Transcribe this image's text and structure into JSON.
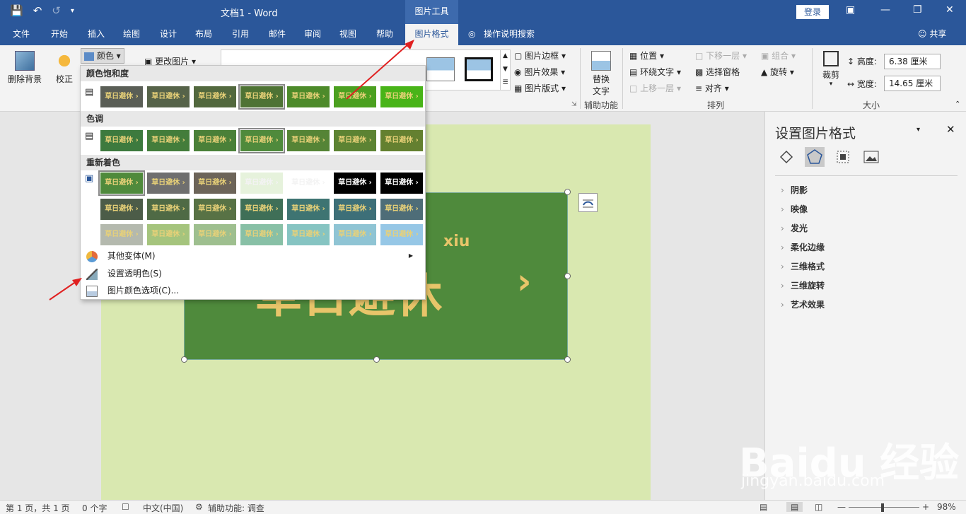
{
  "titlebar": {
    "doc_title": "文档1  -  Word",
    "tool_context": "图片工具",
    "login": "登录",
    "save_icon": "save-icon",
    "undo_icon": "undo-icon"
  },
  "tabs": [
    "文件",
    "开始",
    "插入",
    "绘图",
    "设计",
    "布局",
    "引用",
    "邮件",
    "审阅",
    "视图",
    "帮助",
    "图片格式"
  ],
  "search_label": "操作说明搜索",
  "share_label": "共享",
  "ribbon": {
    "remove_bg": "删除背景",
    "correct": "校正",
    "color": "颜色",
    "change_pic": "更改图片",
    "pic_border": "图片边框",
    "pic_effects": "图片效果",
    "pic_layout": "图片版式",
    "alt_text_1": "替换",
    "alt_text_2": "文字",
    "accessibility_group": "辅助功能",
    "position": "位置",
    "wrap_text": "环绕文字",
    "bring_forward": "上移一层",
    "send_backward": "下移一层",
    "selection_pane": "选择窗格",
    "align": "对齐",
    "group": "组合",
    "rotate": "旋转",
    "arrange_group": "排列",
    "crop": "裁剪",
    "height_label": "高度:",
    "height_value": "6.38 厘米",
    "width_label": "宽度:",
    "width_value": "14.65 厘米",
    "size_group": "大小"
  },
  "dropdown": {
    "section_saturation": "颜色饱和度",
    "section_tone": "色调",
    "section_recolor": "重新着色",
    "swatch_text": "草日避休 ›",
    "more_variants": "其他变体(M)",
    "set_transparent": "设置透明色(S)",
    "color_options": "图片颜色选项(C)...",
    "saturation_colors": [
      "#5a5e56",
      "#566349",
      "#52683e",
      "#4e7334",
      "#4d8a2a",
      "#4ba020",
      "#48b418"
    ],
    "tone_colors": [
      "#3d7a3e",
      "#437d3b",
      "#4a8038",
      "#4f8a3c",
      "#558436",
      "#5c8333",
      "#648030"
    ],
    "recolor_row1": [
      "#4f8a3c",
      "#6f6f6f",
      "#6c6459",
      "#e6f2dc",
      "#ffffff",
      "#000000",
      "#000000"
    ],
    "recolor_row2": [
      "#4c5c48",
      "#4f6a45",
      "#587245",
      "#3f6f57",
      "#3e7472",
      "#3d6f78",
      "#4e6d78"
    ],
    "recolor_row3": [
      "#b4b9ae",
      "#a5c47d",
      "#9ebf8f",
      "#88c0a6",
      "#86c4c2",
      "#8fc4d4",
      "#96c7e6"
    ]
  },
  "picture": {
    "small_text": "xiu",
    "big_text": "草日避休",
    "arrow_text": "›"
  },
  "pane": {
    "title": "设置图片格式",
    "items": [
      "阴影",
      "映像",
      "发光",
      "柔化边缘",
      "三维格式",
      "三维旋转",
      "艺术效果"
    ]
  },
  "status": {
    "page": "第 1 页，共 1 页",
    "words": "0 个字",
    "lang": "中文(中国)",
    "accessibility": "辅助功能: 调查",
    "zoom": "98%"
  },
  "watermark": {
    "logo": "Baidu 经验",
    "url": "jingyan.baidu.com"
  },
  "colors": {
    "brand": "#2b579a",
    "picture_bg": "#4f8a3c",
    "page_bg": "#d9e8b0",
    "arrow": "#e02020"
  }
}
